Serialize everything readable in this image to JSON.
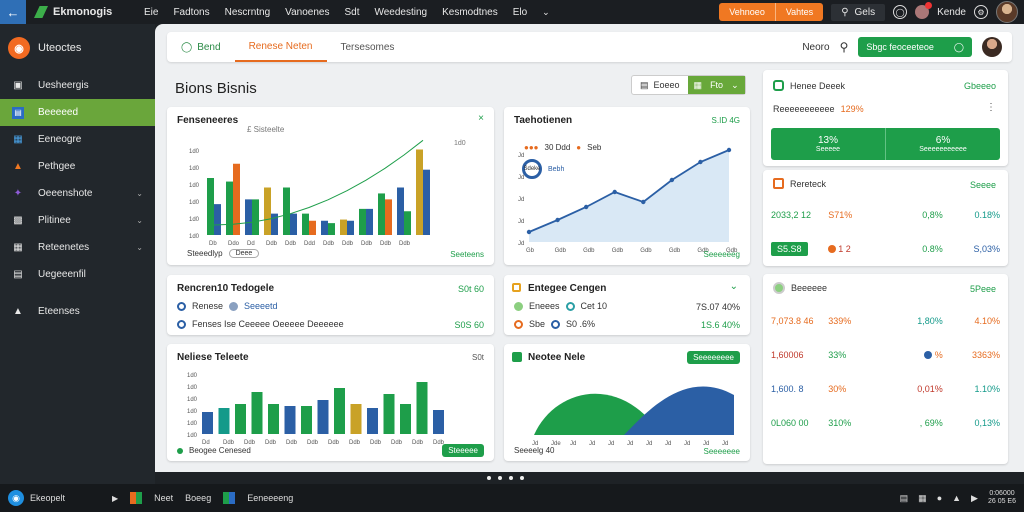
{
  "topbar": {
    "app_name": "Ekmonogis",
    "menu": [
      "Eie",
      "Fadtons",
      "Nescrntng",
      "Vanoenes",
      "Sdt",
      "Weedesting",
      "Kesmodtnes",
      "Elo"
    ],
    "orange_btn_1": "Vehnoeo",
    "orange_btn_2": "Vahtes",
    "grid_label": "Gels",
    "user_name": "Kende"
  },
  "sidebar": {
    "title": "Uteoctes",
    "items": [
      {
        "label": "Uesheergis",
        "icon": "home-icon"
      },
      {
        "label": "Beeeeed",
        "icon": "document-icon",
        "active": true
      },
      {
        "label": "Eeneogre",
        "icon": "layers-icon"
      },
      {
        "label": "Pethgee",
        "icon": "chart-icon"
      },
      {
        "label": "Oeeenshote",
        "icon": "puzzle-icon",
        "arrow": true
      },
      {
        "label": "Plitinee",
        "icon": "table-icon",
        "arrow": true
      },
      {
        "label": "Reteenetes",
        "icon": "grid-icon",
        "arrow": true
      },
      {
        "label": "Uegeeenfil",
        "icon": "doc-icon"
      },
      {
        "label": "Eteenses",
        "icon": "stats-icon"
      }
    ]
  },
  "tabs": {
    "items": [
      "Bend",
      "Renese Neten",
      "Tersesomes"
    ],
    "right_label": "Neoro",
    "cta": "Sbgc feoceeteoe"
  },
  "page": {
    "title": "Bions Bisnis",
    "filter_1": "Eoeeo",
    "filter_2": "Fto"
  },
  "card1": {
    "title": "Fenseneeres",
    "legend": "Seeteldtn",
    "x_ticks": [
      "Db",
      "Ddo",
      "Dd",
      "Ddb",
      "Ddb",
      "Ddd",
      "Ddb",
      "Ddb",
      "Ddb",
      "Ddb",
      "Ddb"
    ],
    "y_ticks": [
      "1d0",
      "1d0",
      "1d0",
      "1d0",
      "1d0",
      "1d0"
    ],
    "footer_left": "Steeedlyp",
    "footer_btn": "Deee",
    "footer_right": "Seeteens",
    "note": "£ Sisteelte"
  },
  "card2": {
    "title": "Taehotienen",
    "tag1": "30 Ddd",
    "tag2": "Seb",
    "sub": "Bebh",
    "badge": "Sdeke",
    "corner": "S.ID 4G",
    "x_ticks": [
      "Gb",
      "Gdb",
      "Gdb",
      "Gdb",
      "Gdb",
      "Gdb",
      "Gdb",
      "Gdb"
    ],
    "y_ticks": [
      "Jd",
      "Jd",
      "Jd",
      "Jd",
      "Jd"
    ],
    "footer": "Seeeeeeg"
  },
  "card3": {
    "title": "Rencren10 Tedogele",
    "value": "S0t 60",
    "row1_a": "Renese",
    "row1_b": "Seeeetd",
    "row2": "Fenses Ise Ceeeee Oeeeee Deeeeee",
    "row2_value": "S0S 60"
  },
  "card4": {
    "title": "Entegee Cengen",
    "row1_a": "Eneees",
    "row1_b": "Cet 10",
    "row1_value": "7S.07 40%",
    "row2_a": "Sbe",
    "row2_b": "S0 .6%",
    "row2_value": "1S.6 40%"
  },
  "card5": {
    "title": "Neliese Teleete",
    "corner": "S0t",
    "y_ticks": [
      "1d0",
      "1d0",
      "1d0",
      "1d0",
      "1d0",
      "1d0"
    ],
    "x_ticks": [
      "Dd",
      "Ddb",
      "Ddb",
      "Ddb",
      "Ddb",
      "Ddb",
      "Ddb",
      "Ddb",
      "Ddb",
      "Ddb",
      "Ddb",
      "Ddb"
    ],
    "legend": "Beogee Cenesed",
    "btn": "Steeeee"
  },
  "card6": {
    "title": "Neotee Nele",
    "btn": "Seeeeeeee",
    "x_ticks": [
      "Jd",
      "Jde",
      "Jd",
      "Jd",
      "Jd",
      "Jd",
      "Jd",
      "Jd",
      "Jd",
      "Jd",
      "Jd"
    ],
    "footer": "Seeeelg 40",
    "footer_right": "Seeeeeee"
  },
  "right1": {
    "title": "Henee Deeek",
    "corner": "Gbeeeo",
    "sub": "Reeeeeeeeeee",
    "sub_value": "129%",
    "tile1_value": "13%",
    "tile1_label": "Seeeee",
    "tile2_value": "6%",
    "tile2_label": "Seeeeeeeeeee"
  },
  "right2": {
    "title": "Rereteck",
    "corner": "Seeee",
    "row1": [
      "2033,2 12",
      "S71%",
      "0,8%",
      "0.18%"
    ],
    "row2_btn": "S5.S8",
    "row2": [
      "1 2",
      "0.8%",
      "S,03%"
    ]
  },
  "right3": {
    "title": "Beeeeee",
    "corner": "5Peee",
    "rows": [
      [
        "7,073.8 46",
        "339%",
        "1,80%",
        "4.10%"
      ],
      [
        "1,60006",
        "33%",
        "%",
        "3363%"
      ],
      [
        "1,600.   8",
        "30%",
        "0,01%",
        "1.10%"
      ],
      [
        "0L060 00",
        "310%",
        ", 69%",
        "0,13%"
      ]
    ]
  },
  "taskbar": {
    "start": "Ekeopelt",
    "items": [
      "Neet",
      "Boeeg",
      "Eeneeeeng"
    ],
    "clock_1": "0:06000",
    "clock_2": "26 05 E6"
  },
  "chart_data": [
    {
      "type": "bar",
      "series": [
        {
          "name": "a",
          "values": [
            48,
            45,
            30,
            40,
            40,
            18,
            12,
            13,
            22,
            35,
            40,
            72
          ]
        },
        {
          "name": "b",
          "values": [
            26,
            60,
            30,
            18,
            18,
            12,
            10,
            12,
            22,
            30,
            20,
            55
          ]
        }
      ]
    },
    {
      "type": "line",
      "x_ticks": [
        "Gb",
        "Gdb",
        "Gdb",
        "Gdb",
        "Gdb",
        "Gdb",
        "Gdb",
        "Gdb"
      ],
      "values": [
        10,
        22,
        35,
        50,
        40,
        62,
        80,
        92
      ]
    },
    {
      "type": "bar",
      "values": [
        22,
        26,
        30,
        42,
        30,
        28,
        28,
        34,
        46,
        30,
        26,
        40,
        30,
        52,
        24
      ]
    },
    {
      "type": "area",
      "series": [
        {
          "name": "green",
          "values": [
            0,
            45,
            60,
            45,
            10
          ]
        },
        {
          "name": "blue",
          "values": [
            0,
            20,
            55,
            68,
            40
          ]
        }
      ]
    }
  ]
}
